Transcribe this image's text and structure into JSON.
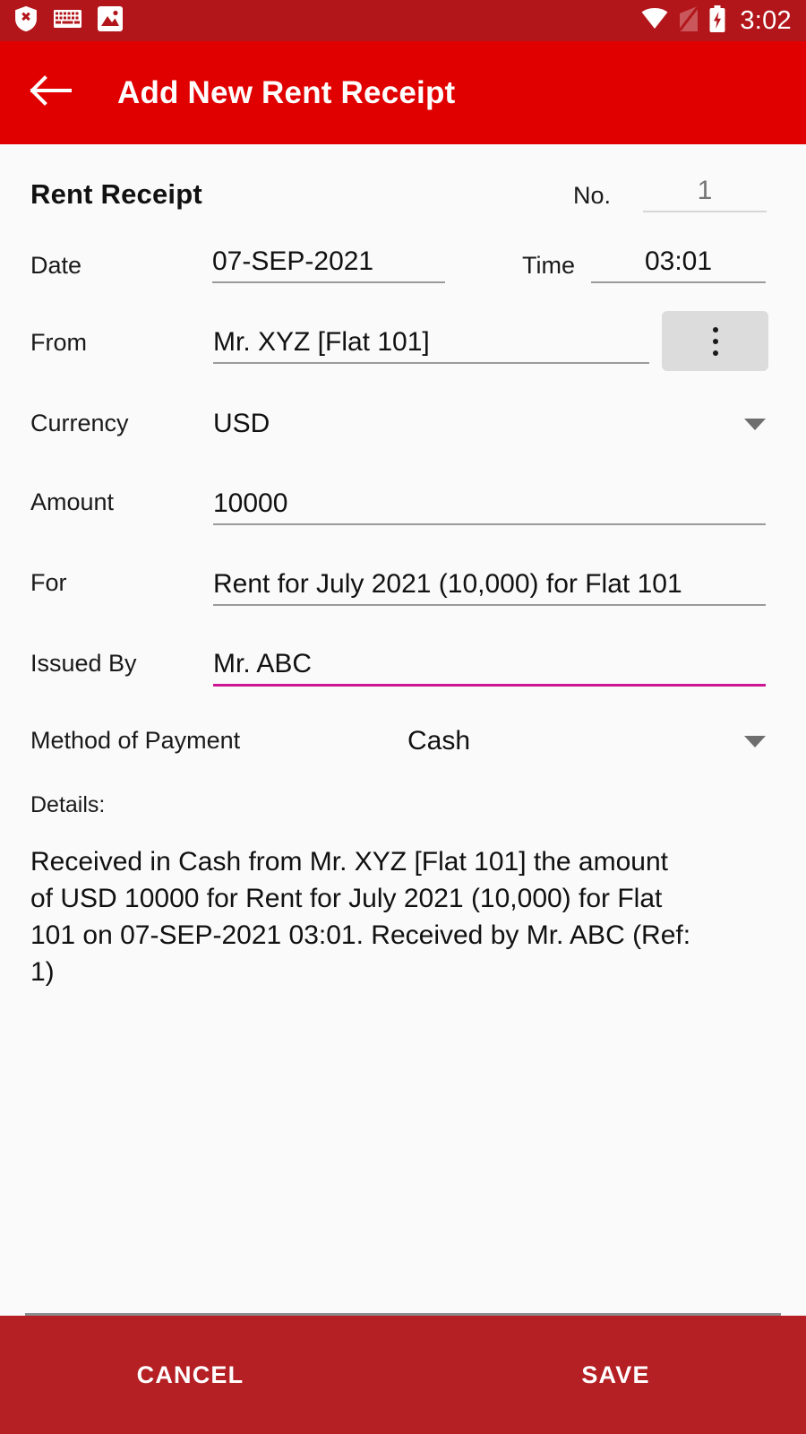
{
  "status_bar": {
    "icons_left": [
      "shield-x-icon",
      "keyboard-icon",
      "image-icon"
    ],
    "icons_right": [
      "wifi-icon",
      "no-sim-icon",
      "battery-charging-icon"
    ],
    "time": "3:02",
    "background_color": "#B3161A"
  },
  "app_bar": {
    "back_icon": "arrow-back-icon",
    "title": "Add New Rent Receipt",
    "background_color": "#E00000"
  },
  "form": {
    "section_title": "Rent Receipt",
    "number": {
      "label": "No.",
      "value": "1"
    },
    "date": {
      "label": "Date",
      "value": "07-SEP-2021"
    },
    "time": {
      "label": "Time",
      "value": "03:01"
    },
    "from": {
      "label": "From",
      "value": "Mr. XYZ [Flat 101]",
      "picker_icon": "kebab-menu-icon"
    },
    "currency": {
      "label": "Currency",
      "value": "USD",
      "caret_icon": "chevron-down-icon"
    },
    "amount": {
      "label": "Amount",
      "value": "10000"
    },
    "for": {
      "label": "For",
      "value": "Rent for July 2021 (10,000) for Flat 101"
    },
    "issued_by": {
      "label": "Issued By",
      "value": "Mr. ABC",
      "focus_color": "#CC1594"
    },
    "method_of_payment": {
      "label": "Method of Payment",
      "value": "Cash",
      "caret_icon": "chevron-down-icon"
    },
    "details": {
      "label": "Details:",
      "text": "Received in Cash from Mr. XYZ [Flat 101] the amount of USD 10000 for Rent for July 2021 (10,000) for Flat 101 on 07-SEP-2021 03:01. Received by Mr. ABC (Ref: 1)"
    }
  },
  "bottom_bar": {
    "cancel_label": "CANCEL",
    "save_label": "SAVE",
    "background_color": "#B52025"
  }
}
